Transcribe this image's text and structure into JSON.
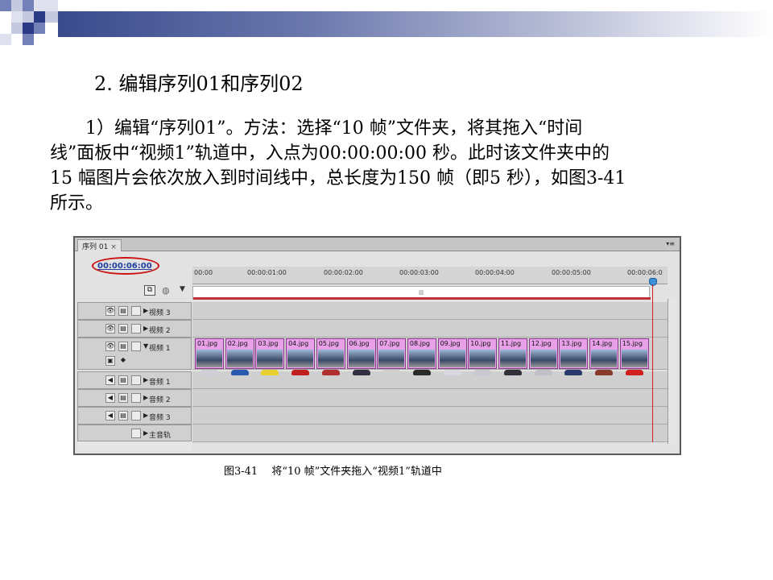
{
  "heading": "2. 编辑序列01和序列02",
  "paragraph": {
    "lines": [
      "　　1）编辑“序列01”。方法：选择“10 帧”文件夹，将其拖入“时间",
      "线”面板中“视频1”轨道中，入点为00:00:00:00 秒。此时该文件夹中的",
      "15 幅图片会依次放入到时间线中，总长度为150 帧（即5 秒），如图3-41",
      "所示。"
    ]
  },
  "panel": {
    "tab_label": "序列 01",
    "tab_close": "×",
    "menu_icon": "▾≡",
    "timecode": "00:00:06:00",
    "ruler_labels": [
      "00:00",
      "00:00:01:00",
      "00:00:02:00",
      "00:00:03:00",
      "00:00:04:00",
      "00:00:05:00",
      "00:00:06:0"
    ],
    "tracks": [
      {
        "label": "视频 3",
        "kind": "video"
      },
      {
        "label": "视频 2",
        "kind": "video"
      },
      {
        "label": "视频 1",
        "kind": "video"
      },
      {
        "label": "音频 1",
        "kind": "audio"
      },
      {
        "label": "音频 2",
        "kind": "audio"
      },
      {
        "label": "音频 3",
        "kind": "audio"
      },
      {
        "label": "主音轨",
        "kind": "master"
      }
    ],
    "clips": [
      "01.jpg",
      "02.jpg",
      "03.jpg",
      "04.jpg",
      "05.jpg",
      "06.jpg",
      "07.jpg",
      "08.jpg",
      "09.jpg",
      "10.jpg",
      "11.jpg",
      "12.jpg",
      "13.jpg",
      "14.jpg",
      "15.jpg"
    ],
    "clip_car_colors": [
      "#cfcfd8",
      "#2a5ab0",
      "#e8d030",
      "#c02020",
      "#b03030",
      "#303040",
      "#d0d0d0",
      "#2a2a2a",
      "#d8d8e0",
      "#c8c8d0",
      "#303038",
      "#c0c0c8",
      "#2a3a6a",
      "#8a3a2a",
      "#d02020"
    ],
    "accent_color": "#cc1010"
  },
  "caption": "图3-41　 将“10 帧”文件夹拖入“视频1”轨道中"
}
